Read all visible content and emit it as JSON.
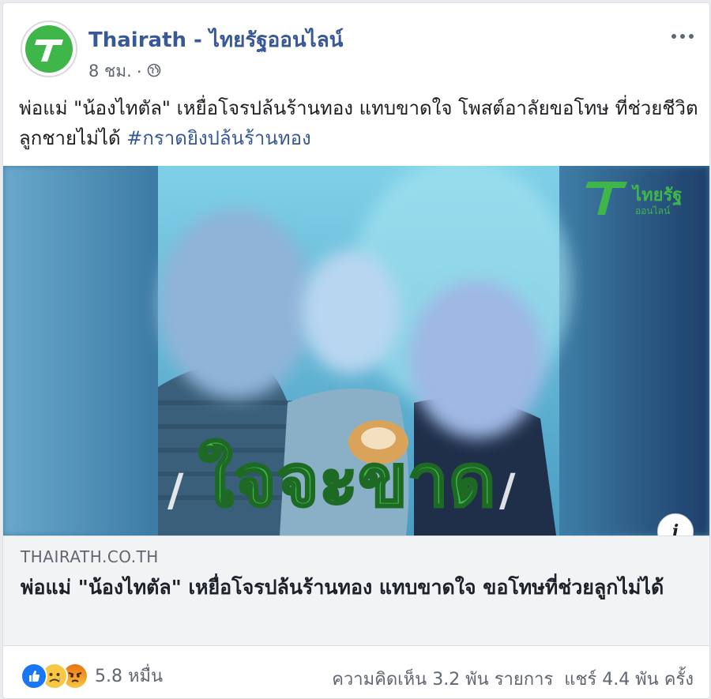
{
  "post": {
    "page_name": "Thairath - ไทยรัฐออนไลน์",
    "time": "8 ชม.",
    "separator": "·",
    "caption_text": "พ่อแม่ \"น้องไทตัล\" เหยื่อโจรปล้นร้านทอง แทบขาดใจ โพสต์อาลัยขอโทษ ที่ช่วยชีวิตลูกชายไม่ได้ ",
    "caption_hashtag": "#กราดยิงปล้นร้านทอง"
  },
  "media": {
    "overlay_text": "ใจจะขาด",
    "watermark_main": "ไทยรัฐ",
    "watermark_sub": "ออนไลน์",
    "brand_color": "#3fb64a"
  },
  "link": {
    "domain": "THAIRATH.CO.TH",
    "title": "พ่อแม่ \"น้องไทตัล\" เหยื่อโจรปล้นร้านทอง แทบขาดใจ ขอโทษที่ช่วยลูกไม่ได้"
  },
  "footer": {
    "reaction_icons": [
      "like-icon",
      "sad-icon",
      "angry-icon"
    ],
    "reaction_count": "5.8 หมื่น",
    "comments": "ความคิดเห็น 3.2 พัน รายการ",
    "shares": "แชร์ 4.4 พัน ครั้ง"
  }
}
